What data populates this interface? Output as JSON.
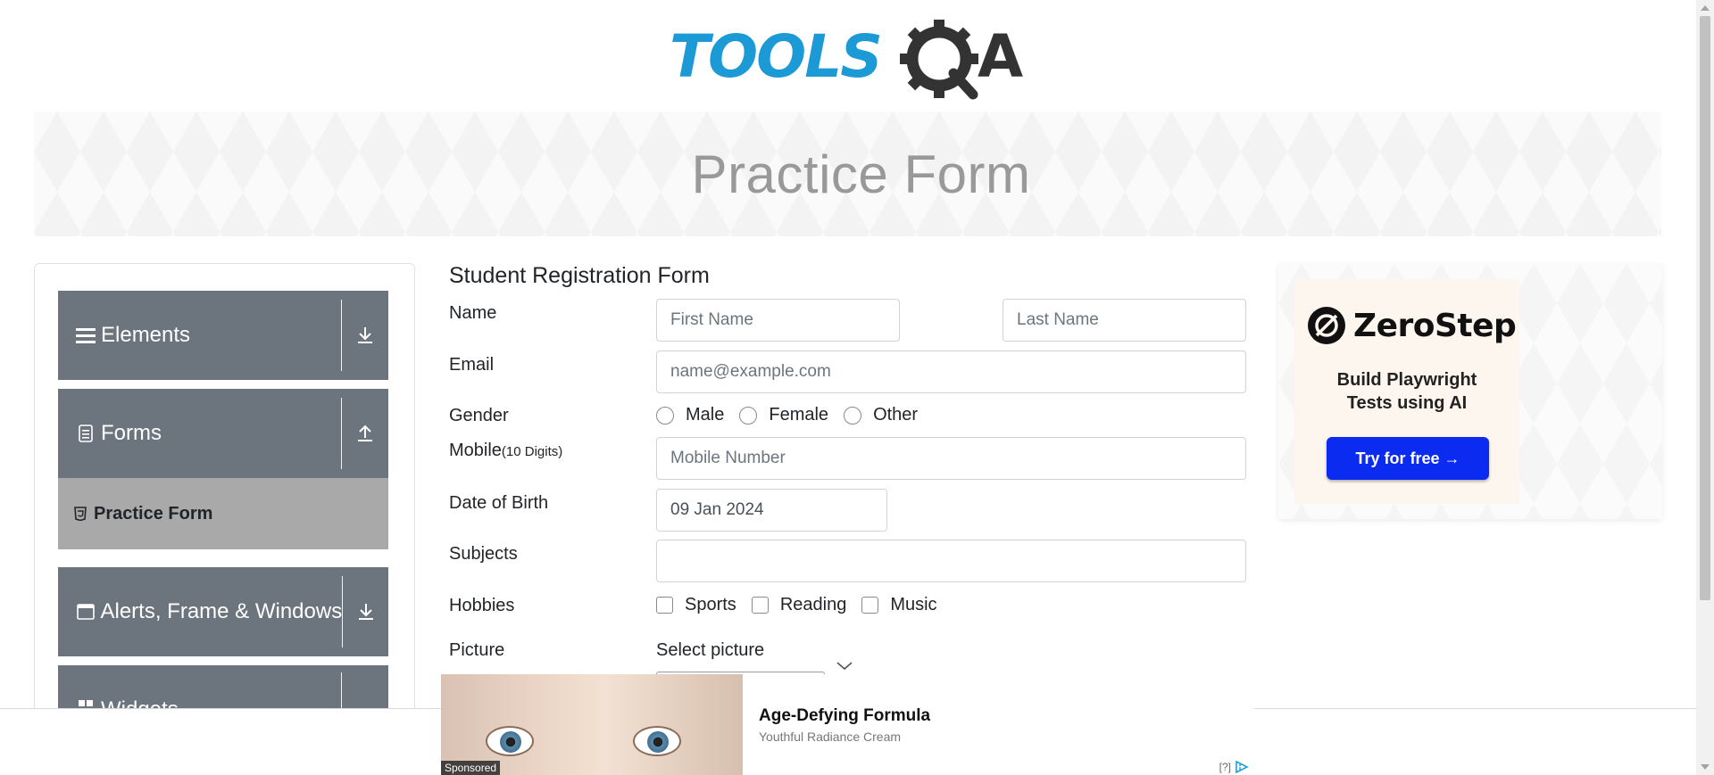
{
  "header": {
    "logo_text": "TOOLSQA",
    "page_title": "Practice Form"
  },
  "sidebar": {
    "groups": [
      {
        "label": "Elements",
        "icon": "hamburger-icon",
        "arrow": "download-arrow-icon"
      },
      {
        "label": "Forms",
        "icon": "document-icon",
        "arrow": "upload-arrow-icon"
      },
      {
        "label": "Alerts, Frame & Windows",
        "icon": "window-icon",
        "arrow": "download-arrow-icon"
      },
      {
        "label": "Widgets",
        "icon": "widget-icon",
        "arrow": "download-arrow-icon"
      }
    ],
    "active_item": {
      "label": "Practice Form",
      "icon": "html5-icon"
    }
  },
  "form": {
    "title": "Student Registration Form",
    "name_label": "Name",
    "first_name_placeholder": "First Name",
    "last_name_placeholder": "Last Name",
    "email_label": "Email",
    "email_placeholder": "name@example.com",
    "gender_label": "Gender",
    "genders": [
      "Male",
      "Female",
      "Other"
    ],
    "mobile_label": "Mobile",
    "mobile_hint": "(10 Digits)",
    "mobile_placeholder": "Mobile Number",
    "dob_label": "Date of Birth",
    "dob_value": "09 Jan 2024",
    "subjects_label": "Subjects",
    "subjects_value": "",
    "hobbies_label": "Hobbies",
    "hobbies": [
      "Sports",
      "Reading",
      "Music"
    ],
    "picture_label": "Picture",
    "picture_text": "Select picture"
  },
  "ad_right": {
    "brand": "ZeroStep",
    "tagline_line1": "Build Playwright",
    "tagline_line2": "Tests using AI",
    "button": "Try for free →"
  },
  "ad_bottom": {
    "title": "Age-Defying Formula",
    "subtitle": "Youthful Radiance Cream",
    "sponsored": "Sponsored",
    "help": "[?]"
  },
  "colors": {
    "sidebar_group_bg": "#6c757d",
    "sidebar_active_bg": "#a9a9a9",
    "logo_blue": "#1b9ad6",
    "logo_dark": "#333333",
    "ad_button": "#0b2cf0"
  }
}
